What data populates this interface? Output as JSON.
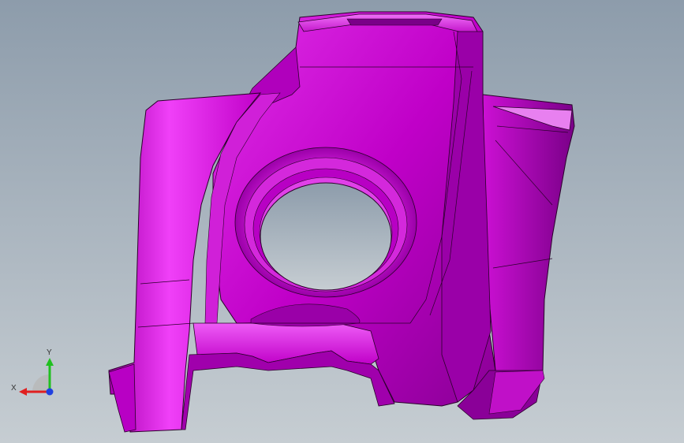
{
  "viewport": {
    "background_top": "#8d9cab",
    "background_bottom": "#c6cdd2"
  },
  "model": {
    "color": "#cc00cc",
    "edge_color": "#2a002a"
  },
  "triad": {
    "x_label": "X",
    "y_label": "Y",
    "x_color": "#e02020",
    "y_color": "#20c020",
    "z_color": "#2040e0"
  }
}
